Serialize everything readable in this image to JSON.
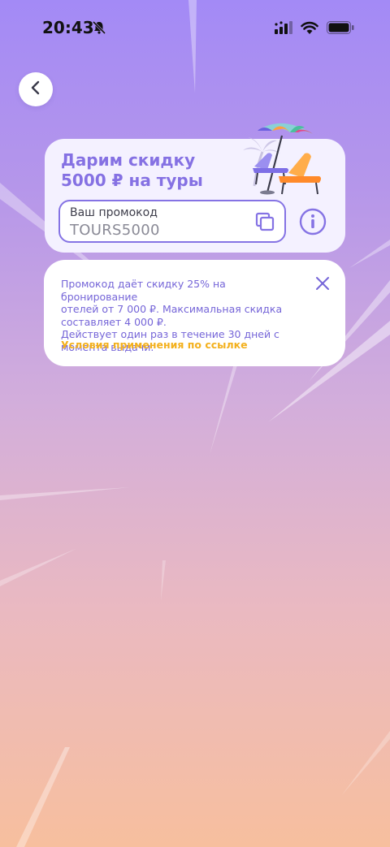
{
  "status_bar": {
    "time": "20:43"
  },
  "promo": {
    "title_line1": "Дарим скидку",
    "title_line2": "5000 ₽ на туры",
    "field_label": "Ваш промокод",
    "code": "TOURS5000"
  },
  "tooltip": {
    "line1": "Промокод даёт скидку 25% на бронирование",
    "line2": "отелей от 7 000 ₽. Максимальная скидка",
    "line3": "составляет 4 000 ₽.",
    "line4": "Действует один раз в течение 30 дней с",
    "line5": "момента выдачи.",
    "link": "Условия применения по ссылке"
  },
  "colors": {
    "accent": "#8571e3",
    "link": "#f3b01c",
    "card_bg": "#f4f1ff"
  },
  "icons": [
    "bell-slash-icon",
    "signal-icon",
    "wifi-icon",
    "battery-icon",
    "chevron-left-icon",
    "copy-icon",
    "info-icon",
    "close-icon",
    "beach-illustration"
  ]
}
